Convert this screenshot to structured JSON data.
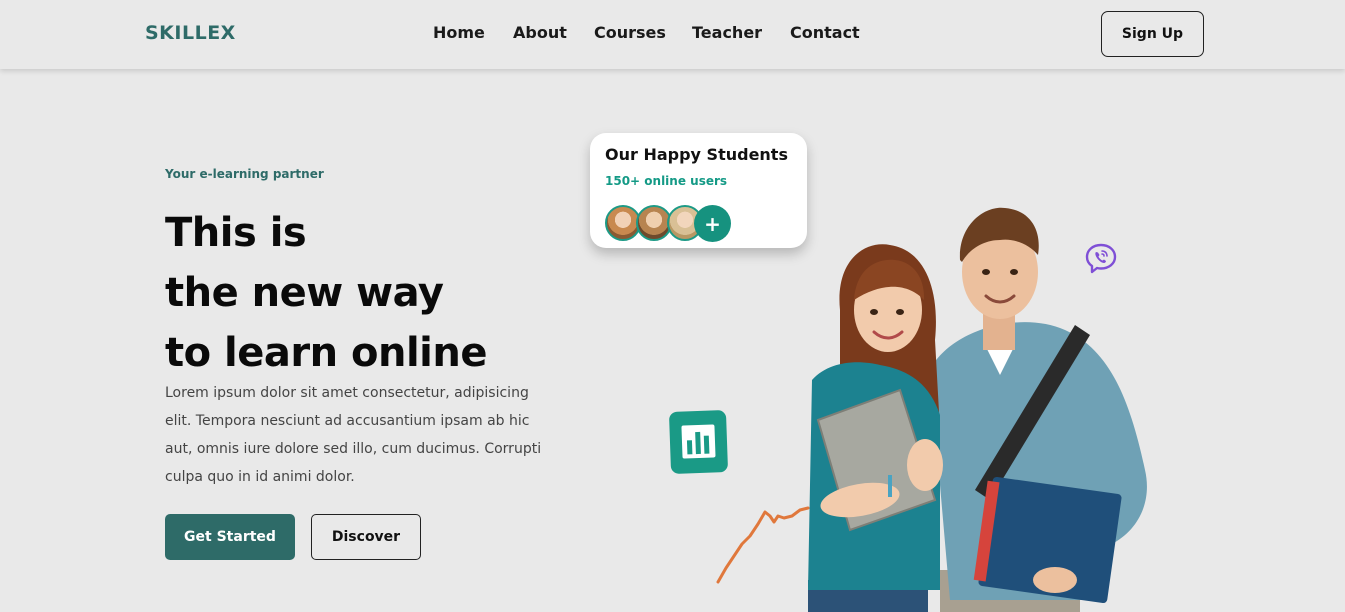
{
  "nav": {
    "logo": "SKILLEX",
    "links": [
      "Home",
      "About",
      "Courses",
      "Teacher",
      "Contact"
    ],
    "signup_label": "Sign Up"
  },
  "hero": {
    "tagline": "Your e-learning partner",
    "headline": [
      "This is",
      "the new way",
      "to learn online"
    ],
    "description": "Lorem ipsum dolor sit amet consectetur, adipisicing elit. Tempora nesciunt ad accusantium ipsam ab hic aut, omnis iure dolore sed illo, cum ducimus. Corrupti culpa quo in id animi dolor.",
    "primary_button": "Get Started",
    "secondary_button": "Discover"
  },
  "students_card": {
    "title": "Our Happy Students",
    "subtitle": "150+ online users",
    "plus_label": "+"
  },
  "colors": {
    "accent": "#2e6b68",
    "teal": "#16927f",
    "background": "#e9e9e9",
    "squiggle": "#e0783c",
    "viber": "#7f4fd6"
  },
  "icons": {
    "chart": "bar-chart-icon",
    "viber": "viber-icon",
    "squiggle": "line-trend-decoration"
  }
}
